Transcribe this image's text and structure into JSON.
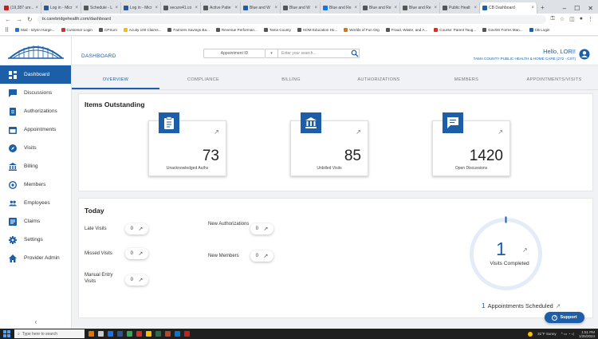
{
  "browser": {
    "tabs": [
      {
        "label": "(19,387 unr...",
        "color": "#c5221f"
      },
      {
        "label": "Log in - Micr",
        "color": "#2b579a"
      },
      {
        "label": "Schedule - L",
        "color": "#555"
      },
      {
        "label": "Log in - Micr",
        "color": "#2b579a"
      },
      {
        "label": "secure41.co",
        "color": "#555"
      },
      {
        "label": "Active Patie",
        "color": "#555"
      },
      {
        "label": "Blue and W",
        "color": "#1c5fa8"
      },
      {
        "label": "Blue and W",
        "color": "#555"
      },
      {
        "label": "Blue and Re",
        "color": "#1a73e8"
      },
      {
        "label": "Blue and Re",
        "color": "#555"
      },
      {
        "label": "Blue and Re",
        "color": "#555"
      },
      {
        "label": "Public Healt",
        "color": "#555"
      },
      {
        "label": "CB Dashboard",
        "color": "#1c5fa8",
        "active": true
      }
    ],
    "new_tab": "+",
    "url": "tx.carebridgehealth.com/dashboard",
    "bookmarks": [
      {
        "label": "Mail - Iolynn Harge...",
        "color": "#1a73e8"
      },
      {
        "label": "Customer Login",
        "color": "#d93025"
      },
      {
        "label": "CPSum",
        "color": "#555"
      },
      {
        "label": "Acuity 100 Claims...",
        "color": "#fbbc04"
      },
      {
        "label": "Farmers Savings Ba...",
        "color": "#555"
      },
      {
        "label": "Revenue Performan...",
        "color": "#555"
      },
      {
        "label": "Tama County",
        "color": "#555"
      },
      {
        "label": "HOM Education Ho...",
        "color": "#555"
      },
      {
        "label": "Worlds of Fun Org",
        "color": "#e37400"
      },
      {
        "label": "Fraud, Waste, and A...",
        "color": "#555"
      },
      {
        "label": "Course: Parent Taug...",
        "color": "#d93025"
      },
      {
        "label": "GovOS Forms Man...",
        "color": "#555"
      },
      {
        "label": "CB Login",
        "color": "#1c5fa8"
      }
    ]
  },
  "sidebar": {
    "items": [
      {
        "label": "Dashboard",
        "icon": "dashboard-icon",
        "active": true
      },
      {
        "label": "Discussions",
        "icon": "chat-icon"
      },
      {
        "label": "Authorizations",
        "icon": "document-icon"
      },
      {
        "label": "Appointments",
        "icon": "calendar-icon"
      },
      {
        "label": "Visits",
        "icon": "compass-icon"
      },
      {
        "label": "Billing",
        "icon": "bank-icon"
      },
      {
        "label": "Members",
        "icon": "members-icon"
      },
      {
        "label": "Employees",
        "icon": "people-icon"
      },
      {
        "label": "Claims",
        "icon": "claims-icon"
      },
      {
        "label": "Settings",
        "icon": "gear-icon"
      },
      {
        "label": "Provider Admin",
        "icon": "home-icon"
      }
    ],
    "collapse_glyph": "‹"
  },
  "header": {
    "title": "DASHBOARD",
    "appointment_select": "Appointment ID",
    "search_placeholder": "Enter your search...",
    "greeting": "Hello, LORI!",
    "organization": "TAMA COUNTY PUBLIC HEALTH & HOME CARE (272 - CST)"
  },
  "nav_tabs": [
    {
      "label": "OVERVIEW",
      "active": true
    },
    {
      "label": "COMPLIANCE"
    },
    {
      "label": "BILLING"
    },
    {
      "label": "AUTHORIZATIONS"
    },
    {
      "label": "MEMBERS"
    },
    {
      "label": "APPOINTMENTS/VISITS"
    }
  ],
  "items_outstanding": {
    "title": "Items Outstanding",
    "cards": [
      {
        "value": "73",
        "label": "Unacknowledged Auths",
        "icon": "clipboard-icon"
      },
      {
        "value": "85",
        "label": "Unbilled Visits",
        "icon": "bank-icon"
      },
      {
        "value": "1420",
        "label": "Open Discussions",
        "icon": "chat-icon"
      }
    ],
    "arrow": "↗"
  },
  "today": {
    "title": "Today",
    "metrics": {
      "late_visits": {
        "label": "Late Visits",
        "value": "0"
      },
      "missed_visits": {
        "label": "Missed Visits",
        "value": "0"
      },
      "manual_entry_visits": {
        "label": "Manual Entry Visits",
        "value": "0"
      },
      "new_authorizations": {
        "label": "New Authorizations",
        "value": "0"
      },
      "new_members": {
        "label": "New Members",
        "value": "0"
      }
    },
    "arrow": "↗",
    "visits_completed": {
      "value": "1",
      "label": "Visits Completed"
    },
    "appointments_scheduled": {
      "value": "1",
      "label": "Appointments Scheduled"
    }
  },
  "support_label": "Support",
  "taskbar": {
    "search_placeholder": "Type here to search",
    "weather": "31°F Sunny",
    "time": "1:51 PM",
    "date": "1/25/2024"
  },
  "colors": {
    "primary": "#1c5fa8"
  }
}
